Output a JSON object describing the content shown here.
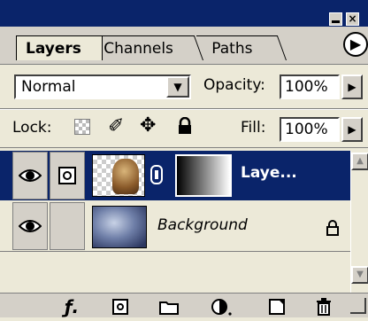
{
  "panel": {
    "close_glyph": "×",
    "tabs": [
      {
        "label": "Layers",
        "active": true
      },
      {
        "label": "Channels",
        "active": false
      },
      {
        "label": "Paths",
        "active": false
      }
    ],
    "menu_icon": "panel-menu-arrow-icon"
  },
  "blend": {
    "mode": "Normal",
    "opacity_label": "Opacity:",
    "opacity_value": "100%"
  },
  "lock": {
    "label": "Lock:",
    "icons": [
      "lock-transparency-icon",
      "lock-image-icon",
      "lock-position-icon",
      "lock-all-icon"
    ],
    "fill_label": "Fill:",
    "fill_value": "100%"
  },
  "layers": [
    {
      "name": "Laye...",
      "visible": true,
      "selected": true,
      "has_mask": true,
      "locked": false
    },
    {
      "name": "Background",
      "visible": true,
      "selected": false,
      "has_mask": false,
      "locked": true
    }
  ],
  "colors": {
    "selection": "#0a246a",
    "panel_bg": "#ece9d8",
    "chrome": "#d4d0c8"
  },
  "toolbar": {
    "icons": [
      "layer-style-icon",
      "add-mask-icon",
      "new-group-icon",
      "adjustment-layer-icon",
      "new-layer-icon",
      "trash-icon"
    ]
  }
}
